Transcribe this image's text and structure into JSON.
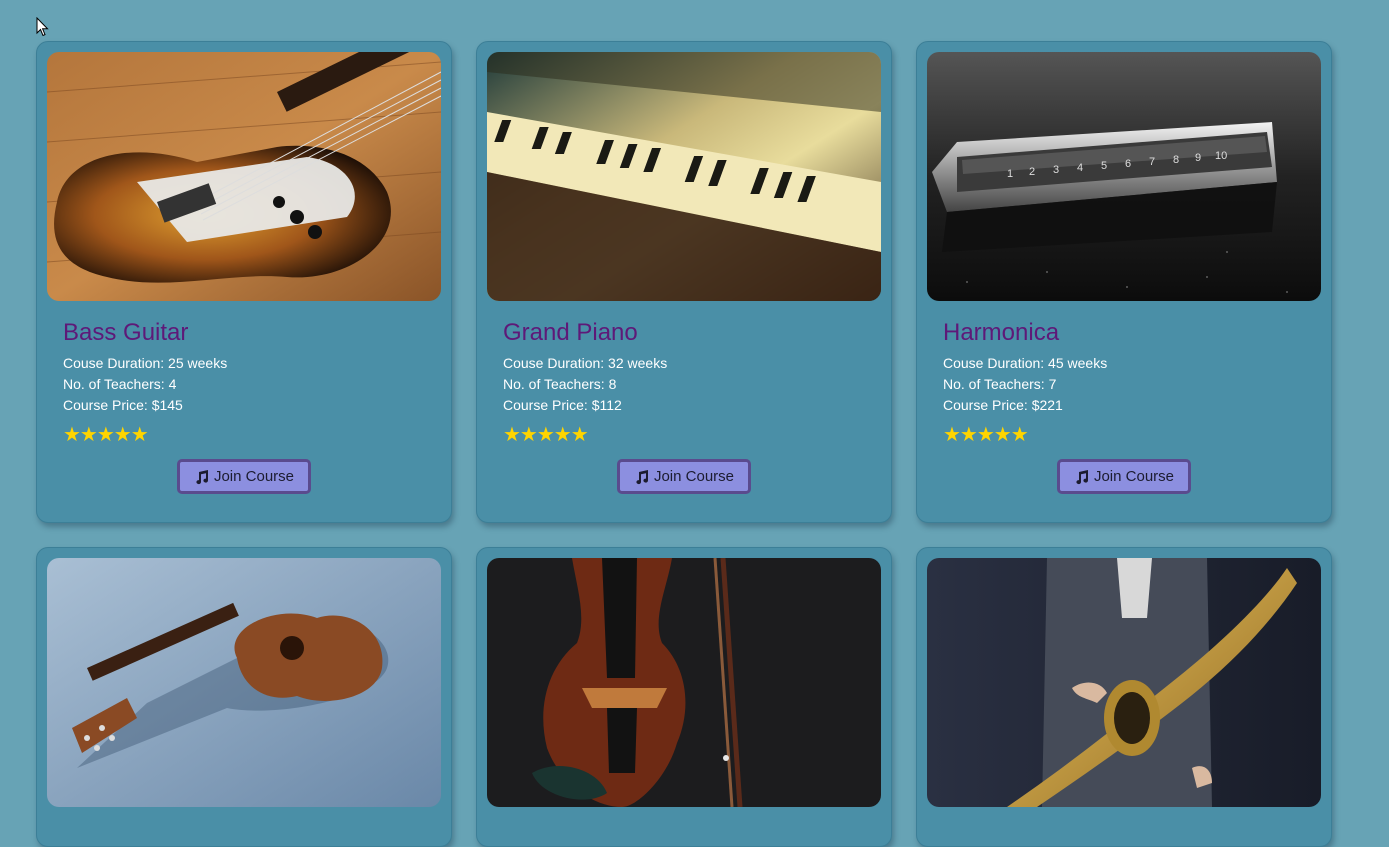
{
  "courses": [
    {
      "title": "Bass Guitar",
      "duration": "Couse Duration: 25 weeks",
      "teachers": "No. of Teachers: 4",
      "price": "Course Price: $145",
      "rating": 5,
      "rating_display": "★★★★★",
      "button_label": "Join Course",
      "image_icon": "bass-guitar-image"
    },
    {
      "title": "Grand Piano",
      "duration": "Couse Duration: 32 weeks",
      "teachers": "No. of Teachers: 8",
      "price": "Course Price: $112",
      "rating": 5,
      "rating_display": "★★★★★",
      "button_label": "Join Course",
      "image_icon": "grand-piano-image"
    },
    {
      "title": "Harmonica",
      "duration": "Couse Duration: 45 weeks",
      "teachers": "No. of Teachers: 7",
      "price": "Course Price: $221",
      "rating": 5,
      "rating_display": "★★★★★",
      "button_label": "Join Course",
      "image_icon": "harmonica-image"
    },
    {
      "image_icon": "ukulele-image"
    },
    {
      "image_icon": "violin-image"
    },
    {
      "image_icon": "saxophone-image"
    }
  ],
  "colors": {
    "background": "#67a3b5",
    "card": "#4a8fa7",
    "title": "#5e1978",
    "button": "#8c8fe0",
    "button_border": "#5a4b8e",
    "star": "#ffd400"
  }
}
